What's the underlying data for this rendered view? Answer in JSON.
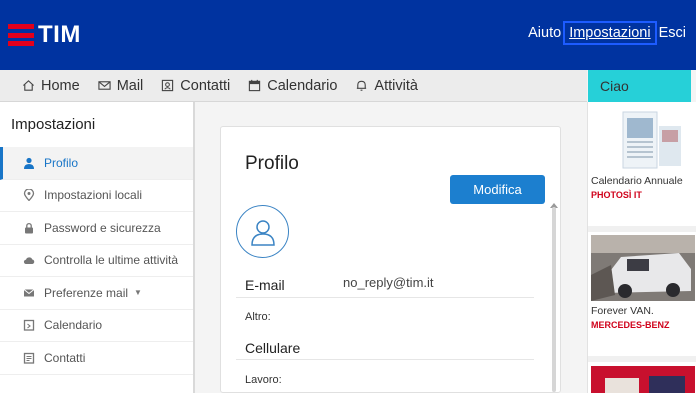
{
  "header": {
    "logo_text": "TIM",
    "links": [
      "Aiuto",
      "Impostazioni",
      "Esci"
    ]
  },
  "nav": {
    "items": [
      {
        "label": "Home",
        "icon": "home-icon"
      },
      {
        "label": "Mail",
        "icon": "mail-icon"
      },
      {
        "label": "Contatti",
        "icon": "contacts-icon"
      },
      {
        "label": "Calendario",
        "icon": "calendar-icon"
      },
      {
        "label": "Attività",
        "icon": "bell-icon"
      }
    ],
    "ciao": "Ciao"
  },
  "sidebar": {
    "title": "Impostazioni",
    "items": [
      {
        "label": "Profilo",
        "icon": "person-icon",
        "active": true
      },
      {
        "label": "Impostazioni locali",
        "icon": "location-pin-icon"
      },
      {
        "label": "Password e sicurezza",
        "icon": "lock-icon"
      },
      {
        "label": "Controlla le ultime attività",
        "icon": "cloud-icon"
      },
      {
        "label": "Preferenze mail",
        "icon": "mail-icon"
      },
      {
        "label": "Calendario",
        "icon": "calendar-icon"
      },
      {
        "label": "Contatti",
        "icon": "contacts-icon"
      }
    ]
  },
  "profile": {
    "title": "Profilo",
    "edit_label": "Modifica",
    "email_label": "E-mail",
    "email_value": "no_reply@tim.it",
    "altro_label": "Altro:",
    "cellulare_label": "Cellulare",
    "lavoro_label": "Lavoro:"
  },
  "ads": [
    {
      "title": "Calendario Annuale",
      "brand": "PHOTOSÌ IT"
    },
    {
      "title": "Forever VAN.",
      "brand": "MERCEDES-BENZ"
    }
  ],
  "colors": {
    "header_bg": "#0033a0",
    "brand_red": "#e2001a",
    "accent_blue": "#1c7fcf",
    "ciao_bg": "#26d0d8"
  }
}
